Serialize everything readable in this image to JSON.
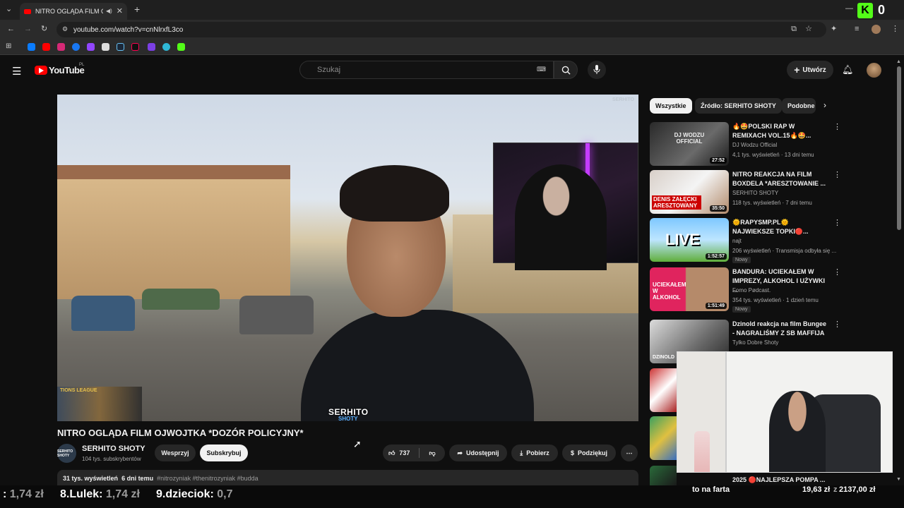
{
  "browser": {
    "tab_title": "NITRO OGLĄDA FILM OJWOJTKA *DOZÓR POLICYJNY* - YouTube",
    "url": "youtube.com/watch?v=cnNlrxfL3co",
    "new_tab": "+",
    "kick_count": "0"
  },
  "youtube": {
    "logo_text": "YouTube",
    "region": "PL",
    "search_placeholder": "Szukaj",
    "create_label": "Utwórz"
  },
  "video": {
    "title": "NITRO OGLĄDA FILM OJWOJTKA *DOZÓR POLICYJNY*",
    "watermark": "SERHITO",
    "watermark_sub": "SHOTY",
    "top_watermark": "SERHITO",
    "strip_text": "TIONS LEAGUE"
  },
  "channel": {
    "avatar_text": "SERHITO SHOTY",
    "name": "SERHITO SHOTY",
    "subscribers": "104 tys. subskrybentów",
    "support_label": "Wesprzyj",
    "subscribe_label": "Subskrybuj"
  },
  "actions": {
    "likes": "737",
    "share": "Udostępnij",
    "download": "Pobierz",
    "thanks": "Podziękuj"
  },
  "description": {
    "views": "31 tys. wyświetleń",
    "date": "6 dni temu",
    "tags": "#nitrozyniak #thenitrozyniak #budda"
  },
  "sidebar": {
    "chips": [
      "Wszystkie",
      "Źródło: SERHITO SHOTY",
      "Podobne"
    ],
    "items": [
      {
        "title": "🔥🤩POLSKI RAP W REMIXACH VOL.15🔥🤩...",
        "channel": "DJ Wodzu Official",
        "meta": "4,1 tys. wyświetleń · 13 dni temu",
        "duration": "27:52",
        "thumb_text": "DJ WODZU OFFICIAL",
        "new": ""
      },
      {
        "title": "NITRO REAKCJA NA FILM BOXDELA *ARESZTOWANIE ...",
        "channel": "SERHITO SHOTY",
        "meta": "118 tys. wyświetleń · 7 dni temu",
        "duration": "35:50",
        "thumb_text": "DENIS ZAŁĘCKI ARESZTOWANY",
        "new": ""
      },
      {
        "title": "🌞RAPYSMP.PL🌞 NAJWIEKSZE TOPKI🔴...",
        "channel": "najt",
        "meta": "206 wyświetleń · Transmisja odbyła się ...",
        "duration": "1:52:57",
        "thumb_text": "LIVE",
        "new": "Nowy"
      },
      {
        "title": "BANDURA: UCIEKAŁEM W IMPREZY, ALKOHOL I UŻYWKI ...",
        "channel": "Fomo Pødcast.",
        "meta": "354 tys. wyświetleń · 1 dzień temu",
        "duration": "1:51:49",
        "thumb_text": "UCIEKAŁEM W ALKOHOL",
        "new": "Nowy"
      },
      {
        "title": "Dzinold reakcja na film Bungee - NAGRALIŚMY Z SB MAFFIJA",
        "channel": "Tylko Dobre Shoty",
        "meta": "",
        "duration": "",
        "thumb_text": "DZINOLD",
        "new": ""
      }
    ],
    "partial_item_title": "2025 🔴NAJLEPSZA POMPA ..."
  },
  "ticker": {
    "item1_prefix": ": ",
    "item1_value": "1,74 zł",
    "item2_name": "8.Lulek: ",
    "item2_value": "1,74 zł",
    "item3_name": "9.dzieciok: ",
    "item3_value": "0,7",
    "goal_label": "to na farta",
    "goal_current": "19,63 zł",
    "goal_sep": "z",
    "goal_target": "2137,00 zł"
  },
  "colors": {
    "bg": "#0f0f0f",
    "accent_red": "#ff0000",
    "kick_green": "#53fc18"
  }
}
